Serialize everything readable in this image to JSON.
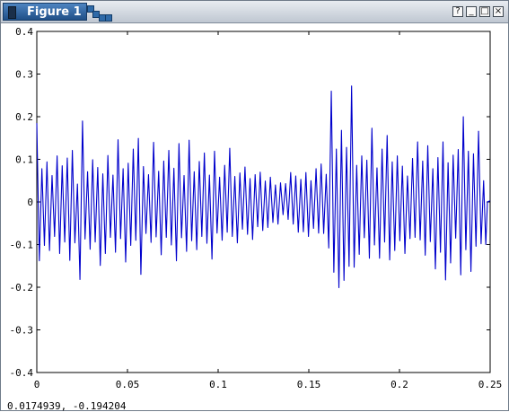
{
  "window": {
    "title": "Figure 1",
    "buttons": [
      "help-icon",
      "minimize-icon",
      "maximize-icon",
      "close-icon"
    ]
  },
  "status_text": "0.0174939, -0.194204",
  "chart_data": {
    "type": "line",
    "title": "",
    "xlabel": "",
    "ylabel": "",
    "xlim": [
      0,
      0.25
    ],
    "ylim": [
      -0.4,
      0.4
    ],
    "x_ticks": [
      "0",
      "0.05",
      "0.1",
      "0.15",
      "0.2",
      "0.25"
    ],
    "y_ticks": [
      "0.4",
      "0.3",
      "0.2",
      "0.1",
      "0",
      "-0.1",
      "-0.2",
      "-0.3",
      "-0.4"
    ],
    "series": [
      {
        "color": "#0000cc",
        "points": [
          [
            0.0,
            0.185
          ],
          [
            0.0014,
            -0.138
          ],
          [
            0.0028,
            0.078
          ],
          [
            0.0042,
            -0.102
          ],
          [
            0.0056,
            0.094
          ],
          [
            0.007,
            -0.114
          ],
          [
            0.0084,
            0.062
          ],
          [
            0.0098,
            -0.081
          ],
          [
            0.0112,
            0.108
          ],
          [
            0.0126,
            -0.121
          ],
          [
            0.014,
            0.085
          ],
          [
            0.0154,
            -0.094
          ],
          [
            0.0168,
            0.103
          ],
          [
            0.0182,
            -0.137
          ],
          [
            0.0196,
            0.121
          ],
          [
            0.021,
            -0.096
          ],
          [
            0.0224,
            0.042
          ],
          [
            0.0238,
            -0.182
          ],
          [
            0.0252,
            0.19
          ],
          [
            0.0266,
            -0.087
          ],
          [
            0.028,
            0.071
          ],
          [
            0.0294,
            -0.111
          ],
          [
            0.0308,
            0.099
          ],
          [
            0.0322,
            -0.094
          ],
          [
            0.0336,
            0.081
          ],
          [
            0.035,
            -0.149
          ],
          [
            0.0364,
            0.066
          ],
          [
            0.0378,
            -0.121
          ],
          [
            0.0392,
            0.109
          ],
          [
            0.0406,
            -0.083
          ],
          [
            0.042,
            0.063
          ],
          [
            0.0434,
            -0.118
          ],
          [
            0.0448,
            0.146
          ],
          [
            0.0462,
            -0.086
          ],
          [
            0.0476,
            0.078
          ],
          [
            0.049,
            -0.141
          ],
          [
            0.0504,
            0.091
          ],
          [
            0.0518,
            -0.102
          ],
          [
            0.0532,
            0.124
          ],
          [
            0.0546,
            -0.09
          ],
          [
            0.056,
            0.149
          ],
          [
            0.0574,
            -0.17
          ],
          [
            0.0588,
            0.083
          ],
          [
            0.0602,
            -0.074
          ],
          [
            0.0616,
            0.064
          ],
          [
            0.063,
            -0.095
          ],
          [
            0.0644,
            0.14
          ],
          [
            0.0658,
            -0.082
          ],
          [
            0.0672,
            0.072
          ],
          [
            0.0686,
            -0.124
          ],
          [
            0.07,
            0.096
          ],
          [
            0.0714,
            -0.083
          ],
          [
            0.0728,
            0.121
          ],
          [
            0.0742,
            -0.101
          ],
          [
            0.0756,
            0.079
          ],
          [
            0.077,
            -0.138
          ],
          [
            0.0784,
            0.137
          ],
          [
            0.0798,
            -0.084
          ],
          [
            0.0812,
            0.062
          ],
          [
            0.0826,
            -0.116
          ],
          [
            0.084,
            0.145
          ],
          [
            0.0854,
            -0.091
          ],
          [
            0.0868,
            0.071
          ],
          [
            0.0882,
            -0.112
          ],
          [
            0.0896,
            0.095
          ],
          [
            0.091,
            -0.081
          ],
          [
            0.0924,
            0.115
          ],
          [
            0.0938,
            -0.097
          ],
          [
            0.0952,
            0.063
          ],
          [
            0.0966,
            -0.134
          ],
          [
            0.098,
            0.119
          ],
          [
            0.0994,
            -0.073
          ],
          [
            0.1008,
            0.058
          ],
          [
            0.1022,
            -0.09
          ],
          [
            0.1036,
            0.086
          ],
          [
            0.105,
            -0.071
          ],
          [
            0.1064,
            0.126
          ],
          [
            0.1078,
            -0.081
          ],
          [
            0.1092,
            0.06
          ],
          [
            0.1106,
            -0.096
          ],
          [
            0.112,
            0.068
          ],
          [
            0.1134,
            -0.064
          ],
          [
            0.1148,
            0.082
          ],
          [
            0.1162,
            -0.076
          ],
          [
            0.1176,
            0.055
          ],
          [
            0.119,
            -0.088
          ],
          [
            0.1204,
            0.064
          ],
          [
            0.1218,
            -0.058
          ],
          [
            0.1232,
            0.07
          ],
          [
            0.1246,
            -0.067
          ],
          [
            0.126,
            0.049
          ],
          [
            0.1274,
            -0.06
          ],
          [
            0.1288,
            0.058
          ],
          [
            0.1302,
            -0.048
          ],
          [
            0.1316,
            0.04
          ],
          [
            0.133,
            -0.052
          ],
          [
            0.1344,
            0.045
          ],
          [
            0.1358,
            -0.03
          ],
          [
            0.1372,
            0.043
          ],
          [
            0.1386,
            -0.041
          ],
          [
            0.14,
            0.069
          ],
          [
            0.1414,
            -0.052
          ],
          [
            0.1428,
            0.061
          ],
          [
            0.1442,
            -0.071
          ],
          [
            0.1456,
            0.053
          ],
          [
            0.147,
            -0.07
          ],
          [
            0.1484,
            0.069
          ],
          [
            0.1498,
            -0.081
          ],
          [
            0.1512,
            0.05
          ],
          [
            0.1526,
            -0.062
          ],
          [
            0.154,
            0.078
          ],
          [
            0.1554,
            -0.073
          ],
          [
            0.1568,
            0.089
          ],
          [
            0.1582,
            -0.074
          ],
          [
            0.1596,
            0.065
          ],
          [
            0.161,
            -0.108
          ],
          [
            0.1624,
            0.26
          ],
          [
            0.1638,
            -0.165
          ],
          [
            0.1652,
            0.124
          ],
          [
            0.1666,
            -0.201
          ],
          [
            0.168,
            0.168
          ],
          [
            0.1694,
            -0.184
          ],
          [
            0.1708,
            0.128
          ],
          [
            0.1722,
            -0.151
          ],
          [
            0.1736,
            0.272
          ],
          [
            0.175,
            -0.153
          ],
          [
            0.1764,
            0.086
          ],
          [
            0.1778,
            -0.123
          ],
          [
            0.1792,
            0.108
          ],
          [
            0.1806,
            -0.084
          ],
          [
            0.182,
            0.098
          ],
          [
            0.1834,
            -0.132
          ],
          [
            0.1848,
            0.173
          ],
          [
            0.1862,
            -0.101
          ],
          [
            0.1876,
            0.08
          ],
          [
            0.189,
            -0.132
          ],
          [
            0.1904,
            0.124
          ],
          [
            0.1918,
            -0.094
          ],
          [
            0.1932,
            0.156
          ],
          [
            0.1946,
            -0.136
          ],
          [
            0.196,
            0.094
          ],
          [
            0.1974,
            -0.114
          ],
          [
            0.1988,
            0.108
          ],
          [
            0.2002,
            -0.091
          ],
          [
            0.2016,
            0.084
          ],
          [
            0.203,
            -0.121
          ],
          [
            0.2044,
            0.061
          ],
          [
            0.2058,
            -0.086
          ],
          [
            0.2072,
            0.102
          ],
          [
            0.2086,
            -0.083
          ],
          [
            0.21,
            0.141
          ],
          [
            0.2114,
            -0.089
          ],
          [
            0.2128,
            0.096
          ],
          [
            0.2142,
            -0.125
          ],
          [
            0.2156,
            0.132
          ],
          [
            0.217,
            -0.093
          ],
          [
            0.2184,
            0.078
          ],
          [
            0.2198,
            -0.157
          ],
          [
            0.2212,
            0.104
          ],
          [
            0.2226,
            -0.118
          ],
          [
            0.224,
            0.141
          ],
          [
            0.2254,
            -0.183
          ],
          [
            0.2268,
            0.092
          ],
          [
            0.2282,
            -0.143
          ],
          [
            0.2296,
            0.11
          ],
          [
            0.231,
            -0.085
          ],
          [
            0.2324,
            0.123
          ],
          [
            0.2338,
            -0.171
          ],
          [
            0.2352,
            0.2
          ],
          [
            0.2366,
            -0.112
          ],
          [
            0.238,
            0.119
          ],
          [
            0.2394,
            -0.163
          ],
          [
            0.2408,
            0.113
          ],
          [
            0.2422,
            -0.104
          ],
          [
            0.2436,
            0.166
          ],
          [
            0.245,
            -0.098
          ],
          [
            0.2464,
            0.05
          ],
          [
            0.2476,
            -0.1
          ],
          [
            0.2485,
            0.0
          ],
          [
            0.25,
            0.003
          ]
        ]
      }
    ]
  }
}
